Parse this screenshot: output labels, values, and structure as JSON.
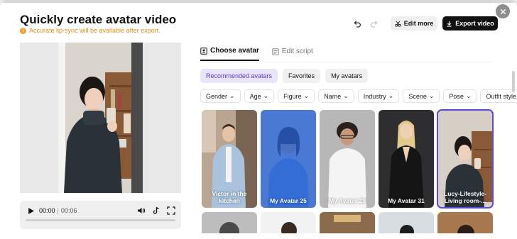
{
  "header": {
    "title": "Quickly create avatar video",
    "notice": "Accurate lip-sync will be available after export.",
    "edit_more": "Edit more",
    "export_video": "Export video"
  },
  "player": {
    "current_time": "00:00",
    "separator": "|",
    "total_time": "00:06",
    "progress": 0
  },
  "tabs": [
    {
      "label": "Choose avatar",
      "active": true
    },
    {
      "label": "Edit script",
      "active": false
    }
  ],
  "chips": [
    "Recommended avatars",
    "Favorites",
    "My avatars"
  ],
  "filters": [
    "Gender",
    "Age",
    "Figure",
    "Name",
    "Industry",
    "Scene",
    "Pose",
    "Outfit style"
  ],
  "avatars": [
    {
      "name": "Victor in the kitchen"
    },
    {
      "name": "My Avatar 25"
    },
    {
      "name": "My Avatar 29"
    },
    {
      "name": "My Avatar 31"
    },
    {
      "name": "Lucy-Lifestyle-Living room-..."
    }
  ],
  "colors": {
    "accent": "#4b3fc9",
    "notice": "#e0901b",
    "export_bg": "#111111",
    "selection_overlay": "#195ad7"
  }
}
